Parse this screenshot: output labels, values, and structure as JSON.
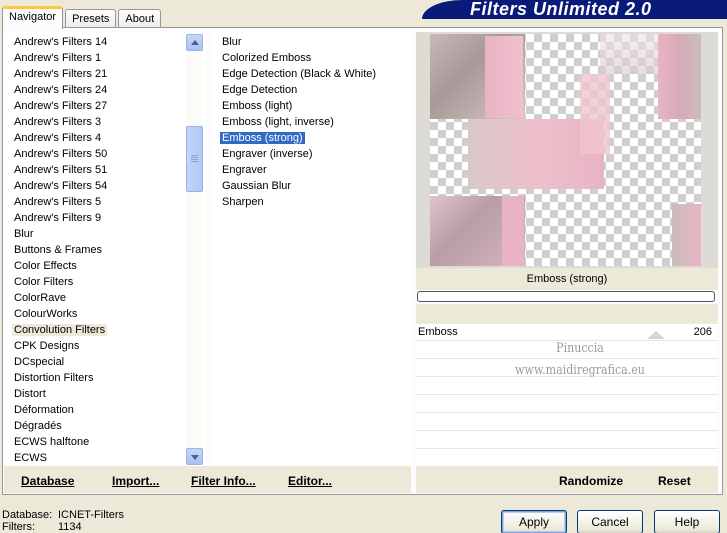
{
  "tabs": [
    {
      "label": "Navigator",
      "active": true
    },
    {
      "label": "Presets",
      "active": false
    },
    {
      "label": "About",
      "active": false
    }
  ],
  "banner_title": "Filters Unlimited 2.0",
  "categories": {
    "items": [
      "Andrew's Filters 14",
      "Andrew's Filters 1",
      "Andrew's Filters 21",
      "Andrew's Filters 24",
      "Andrew's Filters 27",
      "Andrew's Filters 3",
      "Andrew's Filters 4",
      "Andrew's Filters 50",
      "Andrew's Filters 51",
      "Andrew's Filters 54",
      "Andrew's Filters 5",
      "Andrew's Filters 9",
      "Blur",
      "Buttons & Frames",
      "Color Effects",
      "Color Filters",
      "ColorRave",
      "ColourWorks",
      "Convolution Filters",
      "CPK Designs",
      "DCspecial",
      "Distortion Filters",
      "Distort",
      "Déformation",
      "Dégradés",
      "ECWS halftone",
      "ECWS"
    ],
    "selected": "Convolution Filters"
  },
  "filters": {
    "items": [
      "Blur",
      "Colorized Emboss",
      "Edge Detection (Black & White)",
      "Edge Detection",
      "Emboss (light)",
      "Emboss (light, inverse)",
      "Emboss (strong)",
      "Engraver (inverse)",
      "Engraver",
      "Gaussian Blur",
      "Sharpen"
    ],
    "selected": "Emboss (strong)"
  },
  "left_toolbar": {
    "database": "Database",
    "import": "Import...",
    "filter_info": "Filter Info...",
    "editor": "Editor..."
  },
  "right_toolbar": {
    "randomize": "Randomize",
    "reset": "Reset"
  },
  "preview_caption": "Emboss (strong)",
  "progress": 0,
  "params": [
    {
      "label": "Emboss",
      "value": "206"
    }
  ],
  "watermark": {
    "line1": "Pinuccia",
    "line2": "www.maidiregrafica.eu"
  },
  "status": {
    "database_label": "Database:",
    "database_value": "ICNET-Filters",
    "filters_label": "Filters:",
    "filters_value": "1134"
  },
  "buttons": {
    "apply": "Apply",
    "cancel": "Cancel",
    "help": "Help"
  },
  "colors": {
    "selection_blue": "#316ac5",
    "banner_navy": "#0a1a78",
    "dialog_bg": "#ece9d8"
  }
}
